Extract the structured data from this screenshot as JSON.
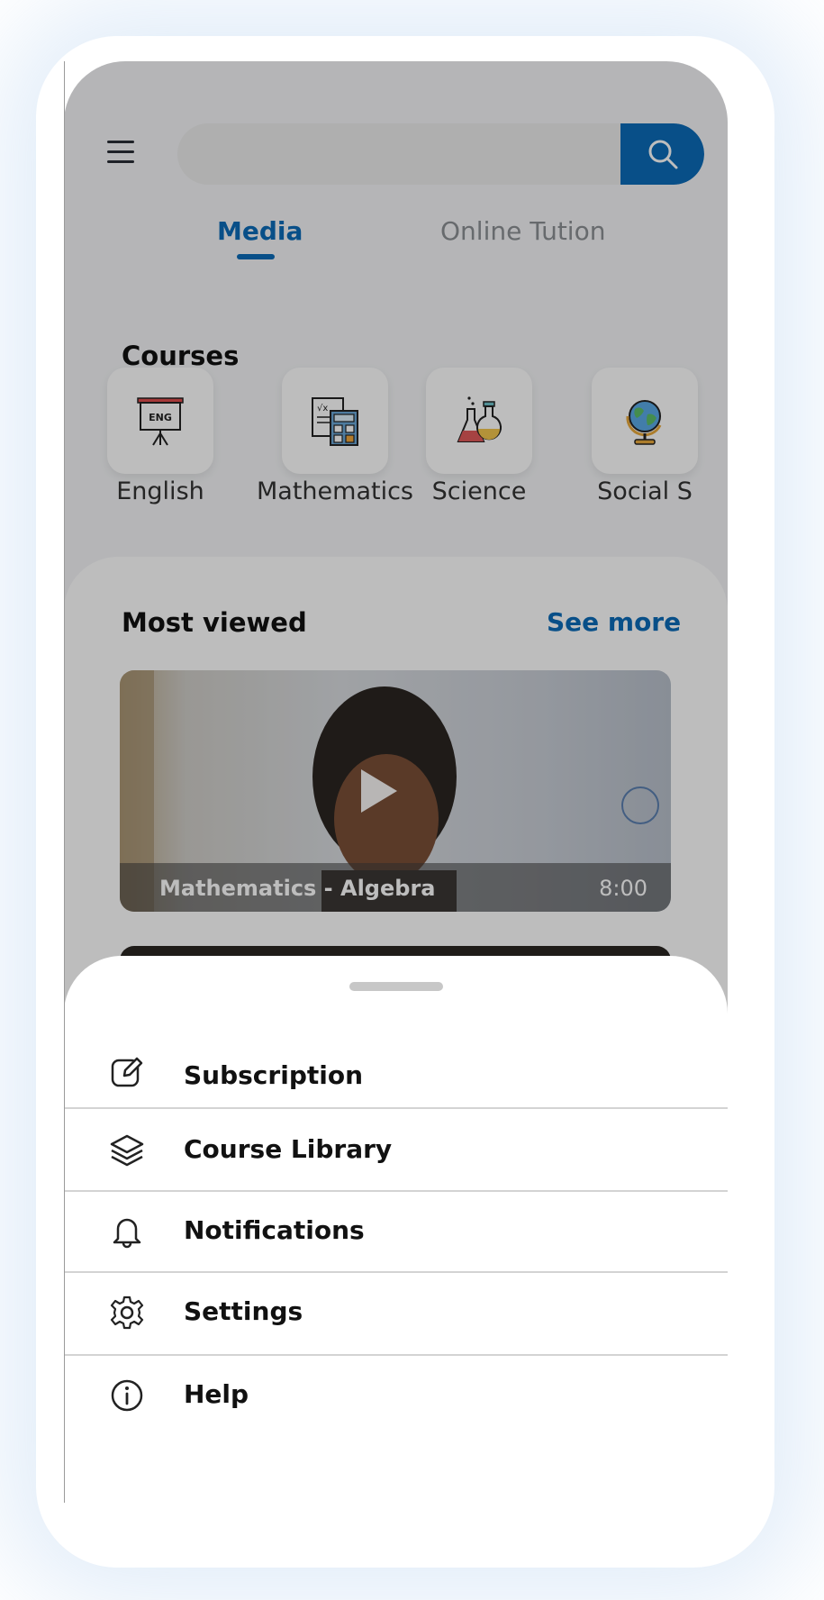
{
  "header": {
    "search": {
      "placeholder": "",
      "value": ""
    },
    "menu_icon": "hamburger-icon",
    "search_icon": "search-icon"
  },
  "tabs": [
    {
      "label": "Media",
      "active": true
    },
    {
      "label": "Online Tution",
      "active": false
    }
  ],
  "courses": {
    "title": "Courses",
    "items": [
      {
        "label": "English",
        "icon": "english-board-icon"
      },
      {
        "label": "Mathematics",
        "icon": "calculator-icon"
      },
      {
        "label": "Science",
        "icon": "flask-icon"
      },
      {
        "label": "Social S",
        "icon": "globe-icon"
      }
    ]
  },
  "most_viewed": {
    "title": "Most viewed",
    "see_more": "See more",
    "videos": [
      {
        "title": "Mathematics - Algebra",
        "duration": "8:00"
      }
    ]
  },
  "menu": {
    "items": [
      {
        "label": "Subscription",
        "icon": "edit-icon"
      },
      {
        "label": "Course Library",
        "icon": "layers-icon"
      },
      {
        "label": "Notifications",
        "icon": "bell-icon"
      },
      {
        "label": "Settings",
        "icon": "gear-icon"
      },
      {
        "label": "Help",
        "icon": "info-icon"
      }
    ]
  },
  "colors": {
    "accent": "#0b6bb8",
    "overlay": "rgba(0,0,0,0.26)"
  }
}
